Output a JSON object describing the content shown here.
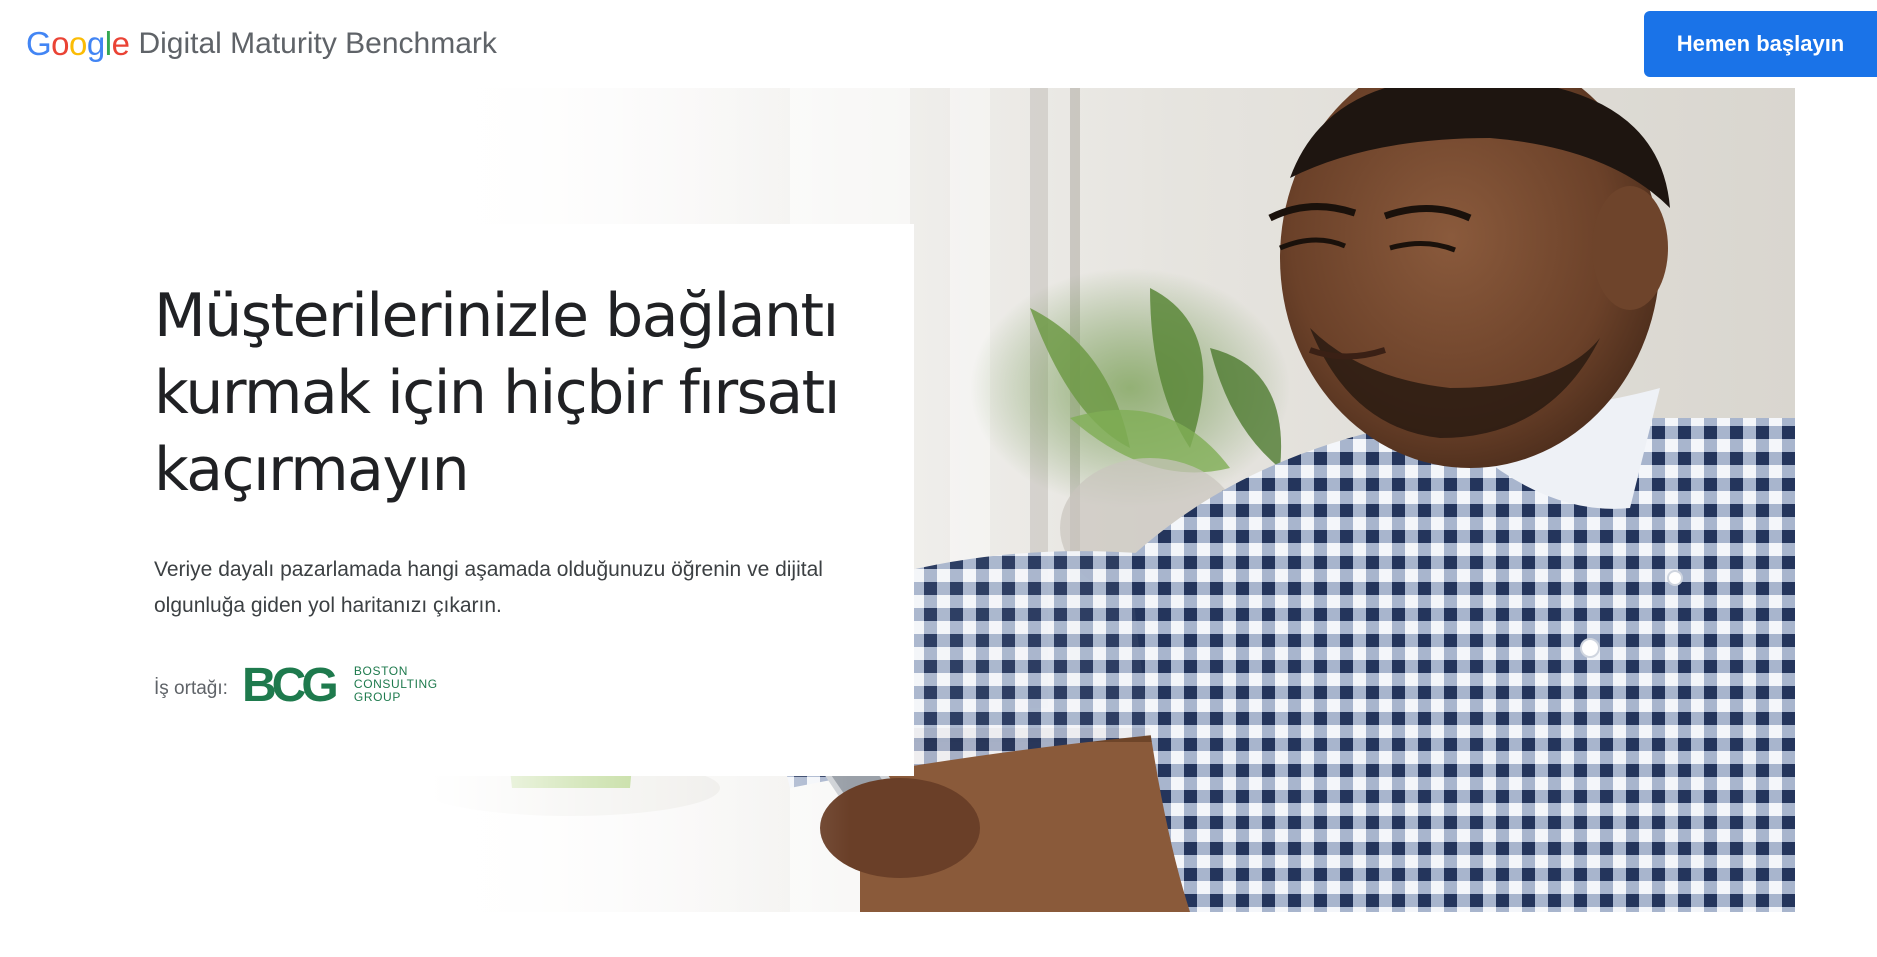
{
  "header": {
    "logo": {
      "letters": [
        {
          "char": "G",
          "color": "#4285F4"
        },
        {
          "char": "o",
          "color": "#EA4335"
        },
        {
          "char": "o",
          "color": "#FBBC05"
        },
        {
          "char": "g",
          "color": "#4285F4"
        },
        {
          "char": "l",
          "color": "#34A853"
        },
        {
          "char": "e",
          "color": "#EA4335"
        }
      ]
    },
    "product_name": "Digital Maturity Benchmark",
    "cta_label": "Hemen başlayın"
  },
  "hero": {
    "headline_lines": [
      "Müşterilerinizle bağlantı",
      "kurmak için hiçbir fırsatı",
      "kaçırmayın"
    ],
    "lead": "Veriye dayalı pazarlamada hangi aşamada olduğunuzu öğrenin ve dijital olgunluğa giden yol haritanızı çıkarın.",
    "partner_label": "İş ortağı:",
    "partner_logo": {
      "mark": "BCG",
      "lines": [
        "BOSTON",
        "CONSULTING",
        "GROUP"
      ],
      "color": "#1E7A4D"
    }
  },
  "colors": {
    "accent": "#1A73E8",
    "text_primary": "#202124",
    "text_secondary": "#5F6368"
  }
}
